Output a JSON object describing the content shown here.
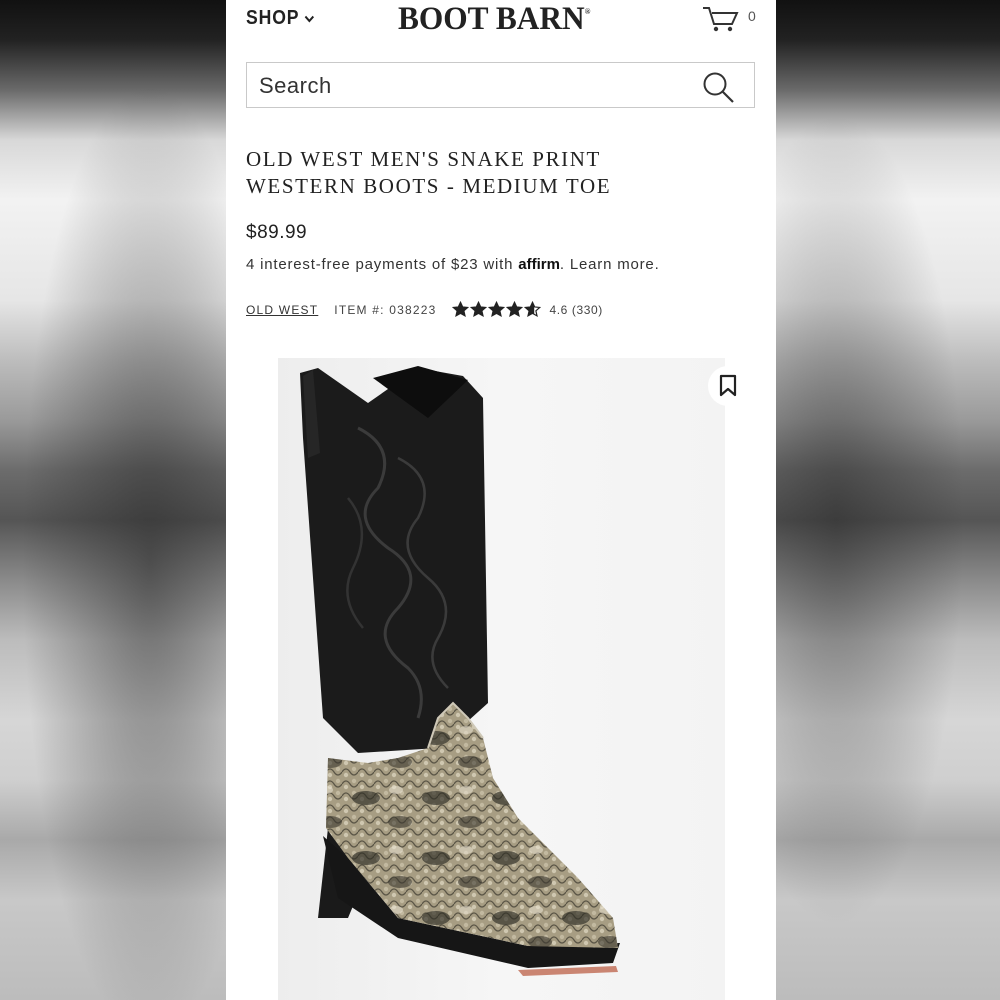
{
  "header": {
    "shop_label": "SHOP",
    "logo_text": "BOOT BARN",
    "logo_mark": "®",
    "cart_count": "0"
  },
  "search": {
    "placeholder": "Search"
  },
  "product": {
    "title": "OLD WEST MEN'S SNAKE PRINT WESTERN BOOTS - MEDIUM TOE",
    "price": "$89.99",
    "installments_prefix": "4 interest-free payments of $23 with",
    "affirm_label": "affirm",
    "learn_more": ". Learn more.",
    "brand": "OLD WEST",
    "item_number": "ITEM #: 038223",
    "rating_text": "4.6 (330)",
    "rating_value": 4.6,
    "rating_max": 5
  },
  "icons": {
    "cart": "cart-icon",
    "search": "search-icon",
    "chevron": "chevron-down-icon",
    "bookmark": "bookmark-icon",
    "star": "star-icon"
  },
  "colors": {
    "text": "#222222",
    "border": "#c9c9c9",
    "boot_shaft": "#1b1b1b",
    "snake_print": "#9a9078"
  }
}
